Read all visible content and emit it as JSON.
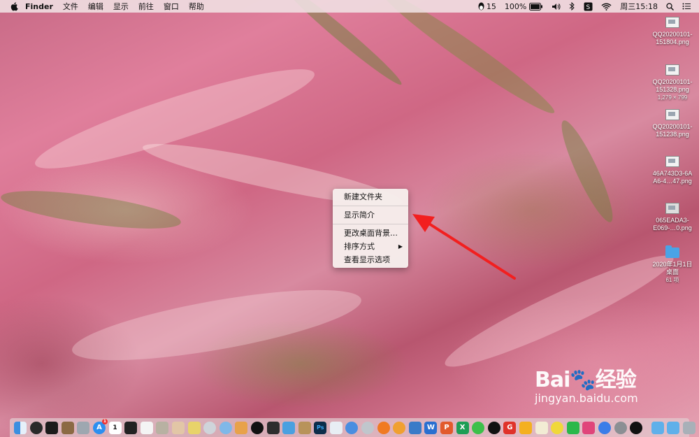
{
  "menubar": {
    "app_name": "Finder",
    "menus": [
      "文件",
      "编辑",
      "显示",
      "前往",
      "窗口",
      "帮助"
    ],
    "qq_count": "15",
    "battery": "100%",
    "clock": "周三15:18"
  },
  "desktop_items": [
    {
      "name_line1": "QQ20200101-",
      "name_line2": "151804.png",
      "meta": ""
    },
    {
      "name_line1": "QQ20200101-",
      "name_line2": "151328.png",
      "meta": "1,279 × 799"
    },
    {
      "name_line1": "QQ20200101-",
      "name_line2": "151238.png",
      "meta": ""
    },
    {
      "name_line1": "46A743D3-6A",
      "name_line2": "A6-4…47.png",
      "meta": ""
    },
    {
      "name_line1": "065EADA3-",
      "name_line2": "E069-…0.png",
      "meta": ""
    },
    {
      "name_line1": "2020年1月1日",
      "name_line2": "桌面",
      "meta": "61 项"
    }
  ],
  "context_menu": {
    "new_folder": "新建文件夹",
    "get_info": "显示简介",
    "change_background": "更改桌面背景…",
    "sort_by": "排序方式",
    "view_options": "查看显示选项"
  },
  "watermark": {
    "brand": "Bai",
    "brand_end": "经验",
    "url": "jingyan.baidu.com"
  },
  "dock": {
    "calendar_day": "1",
    "appstore_badge": "1",
    "photoshop": "Ps",
    "wps": "W"
  }
}
